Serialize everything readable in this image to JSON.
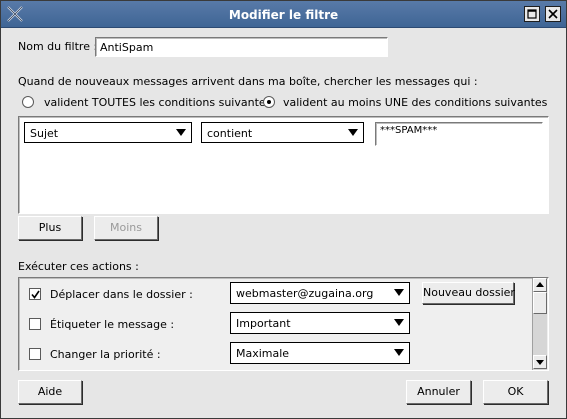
{
  "window": {
    "title": "Modifier le filtre"
  },
  "filter_name": {
    "label": "Nom du filtre :",
    "value": "AntiSpam"
  },
  "match": {
    "description": "Quand de nouveaux messages arrivent dans ma boîte, chercher les messages qui :",
    "options": [
      {
        "label": "valident TOUTES les conditions suivantes",
        "selected": false
      },
      {
        "label": "valident au moins UNE des conditions suivantes",
        "selected": true
      }
    ]
  },
  "conditions": [
    {
      "field": "Sujet",
      "operator": "contient",
      "value": "***SPAM***"
    }
  ],
  "condition_buttons": {
    "more": "Plus",
    "less": "Moins"
  },
  "actions_label": "Exécuter ces actions :",
  "actions": [
    {
      "checked": true,
      "label": "Déplacer dans le dossier :",
      "value": "webmaster@zugaina.org",
      "button": "Nouveau dossier"
    },
    {
      "checked": false,
      "label": "Étiqueter le message :",
      "value": "Important"
    },
    {
      "checked": false,
      "label": "Changer la priorité :",
      "value": "Maximale"
    }
  ],
  "footer": {
    "help": "Aide",
    "cancel": "Annuler",
    "ok": "OK"
  },
  "icons": {
    "app": "filter-x-icon",
    "maximize": "maximize-icon",
    "close": "close-icon"
  },
  "colors": {
    "titlebar": "#4a6f9f",
    "window_bg": "#e6e6e6"
  }
}
